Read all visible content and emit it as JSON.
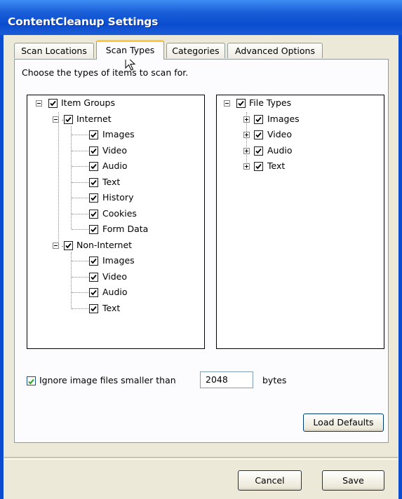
{
  "window": {
    "title": "ContentCleanup Settings"
  },
  "tabs": [
    {
      "label": "Scan Locations",
      "active": false
    },
    {
      "label": "Scan Types",
      "active": true
    },
    {
      "label": "Categories",
      "active": false
    },
    {
      "label": "Advanced Options",
      "active": false
    }
  ],
  "scan_types": {
    "description": "Choose the types of items to scan for.",
    "item_groups": {
      "label": "Item Groups",
      "checked": true,
      "expanded": true,
      "internet": {
        "label": "Internet",
        "checked": true,
        "expanded": true,
        "items": [
          {
            "label": "Images",
            "checked": true
          },
          {
            "label": "Video",
            "checked": true
          },
          {
            "label": "Audio",
            "checked": true
          },
          {
            "label": "Text",
            "checked": true
          },
          {
            "label": "History",
            "checked": true
          },
          {
            "label": "Cookies",
            "checked": true
          },
          {
            "label": "Form Data",
            "checked": true
          }
        ]
      },
      "non_internet": {
        "label": "Non-Internet",
        "checked": true,
        "expanded": true,
        "items": [
          {
            "label": "Images",
            "checked": true
          },
          {
            "label": "Video",
            "checked": true
          },
          {
            "label": "Audio",
            "checked": true
          },
          {
            "label": "Text",
            "checked": true
          }
        ]
      }
    },
    "file_types": {
      "label": "File Types",
      "checked": true,
      "expanded": true,
      "items": [
        {
          "label": "Images",
          "checked": true,
          "expanded": false
        },
        {
          "label": "Video",
          "checked": true,
          "expanded": false
        },
        {
          "label": "Audio",
          "checked": true,
          "expanded": false
        },
        {
          "label": "Text",
          "checked": true,
          "expanded": false
        }
      ]
    },
    "ignore_small_images": {
      "label": "Ignore image files smaller than",
      "checked": true,
      "value": "2048",
      "unit": "bytes"
    },
    "load_defaults_label": "Load Defaults"
  },
  "footer": {
    "cancel_label": "Cancel",
    "save_label": "Save"
  },
  "colors": {
    "title_bar": "#0a4ccf",
    "active_tab_accent": "#ffc83c",
    "dialog_bg": "#ece9d8",
    "check_green": "#21a121"
  }
}
